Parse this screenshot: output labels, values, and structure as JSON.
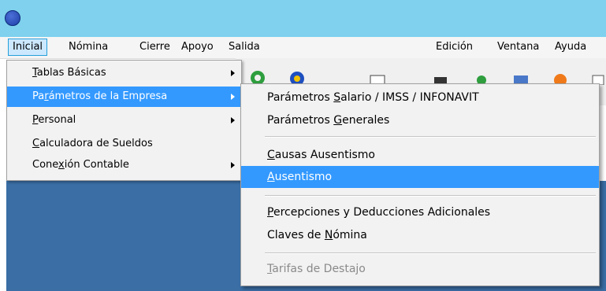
{
  "menubar": {
    "items": [
      "Inicial",
      "Nómina",
      "Cierre",
      "Apoyo",
      "Salida",
      "Edición",
      "Ventana",
      "Ayuda"
    ]
  },
  "inicial_menu": {
    "items": [
      {
        "pre": "",
        "ul": "T",
        "post": "ablas Básicas",
        "submenu": true
      },
      {
        "pre": "Pa",
        "ul": "r",
        "post": "ámetros de la Empresa",
        "submenu": true
      },
      {
        "pre": "",
        "ul": "P",
        "post": "ersonal",
        "submenu": true
      },
      {
        "pre": "",
        "ul": "C",
        "post": "alculadora de Sueldos",
        "submenu": false
      },
      {
        "pre": "Cone",
        "ul": "x",
        "post": "ión Contable",
        "submenu": true
      }
    ]
  },
  "parametros_submenu": {
    "items": [
      {
        "pre": "Parámetros ",
        "ul": "S",
        "post": "alario / IMSS / INFONAVIT"
      },
      {
        "pre": "Parámetros ",
        "ul": "G",
        "post": "enerales"
      },
      {
        "pre": "",
        "ul": "C",
        "post": "ausas Ausentismo"
      },
      {
        "pre": "",
        "ul": "A",
        "post": "usentismo"
      },
      {
        "pre": "",
        "ul": "P",
        "post": "ercepciones y Deducciones Adicionales"
      },
      {
        "pre": "Claves de ",
        "ul": "N",
        "post": "ómina"
      },
      {
        "pre": "",
        "ul": "T",
        "post": "arifas de Destajo"
      }
    ]
  },
  "colors": {
    "titlebar": "#7fd1ee",
    "highlight": "#3399ff",
    "workspace": "#3a6ea5",
    "menu_bg": "#f2f2f2",
    "disabled_text": "#8a8a8a"
  }
}
